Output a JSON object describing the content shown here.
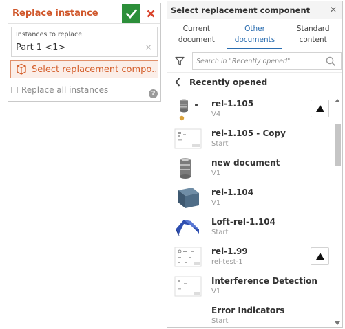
{
  "dialog": {
    "title": "Replace instance",
    "accept_icon": "checkmark-icon",
    "cancel_icon": "close-icon",
    "instances_field": {
      "label": "Instances to replace",
      "value": "Part 1 <1>",
      "clear_icon": "clear-icon"
    },
    "select_button_label": "Select replacement compo...",
    "replace_all_label": "Replace all instances",
    "replace_all_checked": false,
    "help_glyph": "?",
    "colors": {
      "title": "#d0572b",
      "accept_bg": "#2c8f3a",
      "cancel": "#d9432b",
      "select_bg": "#fbeee8"
    }
  },
  "panel": {
    "title": "Select replacement component",
    "close_icon": "close-icon",
    "tabs": [
      {
        "label_line1": "Current",
        "label_line2": "document",
        "active": false
      },
      {
        "label_line1": "Other",
        "label_line2": "documents",
        "active": true
      },
      {
        "label_line1": "Standard",
        "label_line2": "content",
        "active": false
      }
    ],
    "search": {
      "placeholder": "Search in \"Recently opened\"",
      "filter_icon": "filter-icon",
      "search_icon": "search-icon"
    },
    "nav": {
      "label": "Recently opened",
      "back_icon": "chevron-left-icon"
    },
    "items": [
      {
        "name": "rel-1.105",
        "version": "V4",
        "thumbnail": "cylinder-parts-thumbnail",
        "has_up_button": true
      },
      {
        "name": "rel-1.105 - Copy",
        "version": "Start",
        "thumbnail": "drawing-thumbnail",
        "has_up_button": false
      },
      {
        "name": "new document",
        "version": "V1",
        "thumbnail": "cylinder-thumbnail",
        "has_up_button": false
      },
      {
        "name": "rel-1.104",
        "version": "V1",
        "thumbnail": "block-thumbnail",
        "has_up_button": false
      },
      {
        "name": "Loft-rel-1.104",
        "version": "Start",
        "thumbnail": "loft-thumbnail",
        "has_up_button": false
      },
      {
        "name": "rel-1.99",
        "version": "rel-test-1",
        "thumbnail": "drawing-thumbnail",
        "has_up_button": true
      },
      {
        "name": "Interference Detection",
        "version": "V1",
        "thumbnail": "drawing-thumbnail",
        "has_up_button": false
      },
      {
        "name": "Error Indicators",
        "version": "Start",
        "thumbnail": "none",
        "has_up_button": false
      }
    ],
    "active_tab_color": "#2a6db0"
  }
}
